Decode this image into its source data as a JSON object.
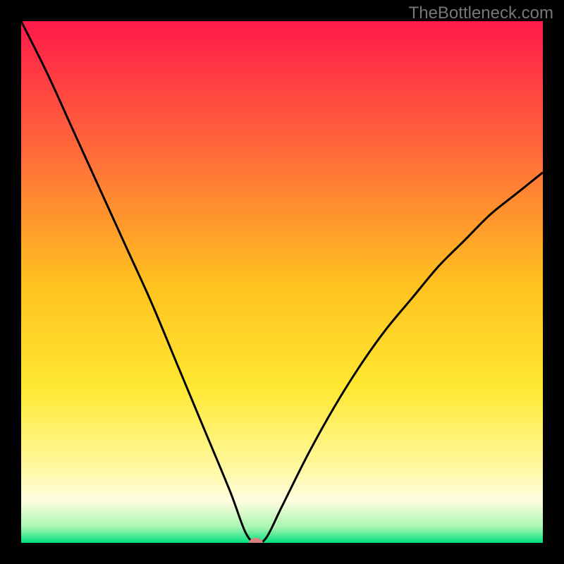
{
  "watermark": "TheBottleneck.com",
  "chart_data": {
    "type": "line",
    "title": "",
    "xlabel": "",
    "ylabel": "",
    "xlim": [
      0,
      100
    ],
    "ylim": [
      0,
      100
    ],
    "x": [
      0,
      5,
      10,
      15,
      20,
      25,
      30,
      35,
      40,
      43,
      45,
      47,
      50,
      55,
      60,
      65,
      70,
      75,
      80,
      85,
      90,
      95,
      100
    ],
    "values": [
      100,
      90,
      79,
      68,
      57,
      46,
      34,
      22,
      10,
      2,
      0,
      1,
      7,
      17,
      26,
      34,
      41,
      47,
      53,
      58,
      63,
      67,
      71
    ],
    "minimum_x": 45,
    "marker": {
      "x": 45,
      "y": 0,
      "color": "#d88080"
    },
    "background": {
      "type": "vertical_gradient",
      "stops": [
        {
          "pos": 0.0,
          "color": "#ff1a4a"
        },
        {
          "pos": 0.25,
          "color": "#ff6a3a"
        },
        {
          "pos": 0.5,
          "color": "#ffc020"
        },
        {
          "pos": 0.7,
          "color": "#ffe830"
        },
        {
          "pos": 0.85,
          "color": "#fff89a"
        },
        {
          "pos": 0.92,
          "color": "#fffde0"
        },
        {
          "pos": 0.97,
          "color": "#a8f5b0"
        },
        {
          "pos": 1.0,
          "color": "#00e080"
        }
      ]
    },
    "frame_color": "#000000",
    "frame_width": 30
  }
}
